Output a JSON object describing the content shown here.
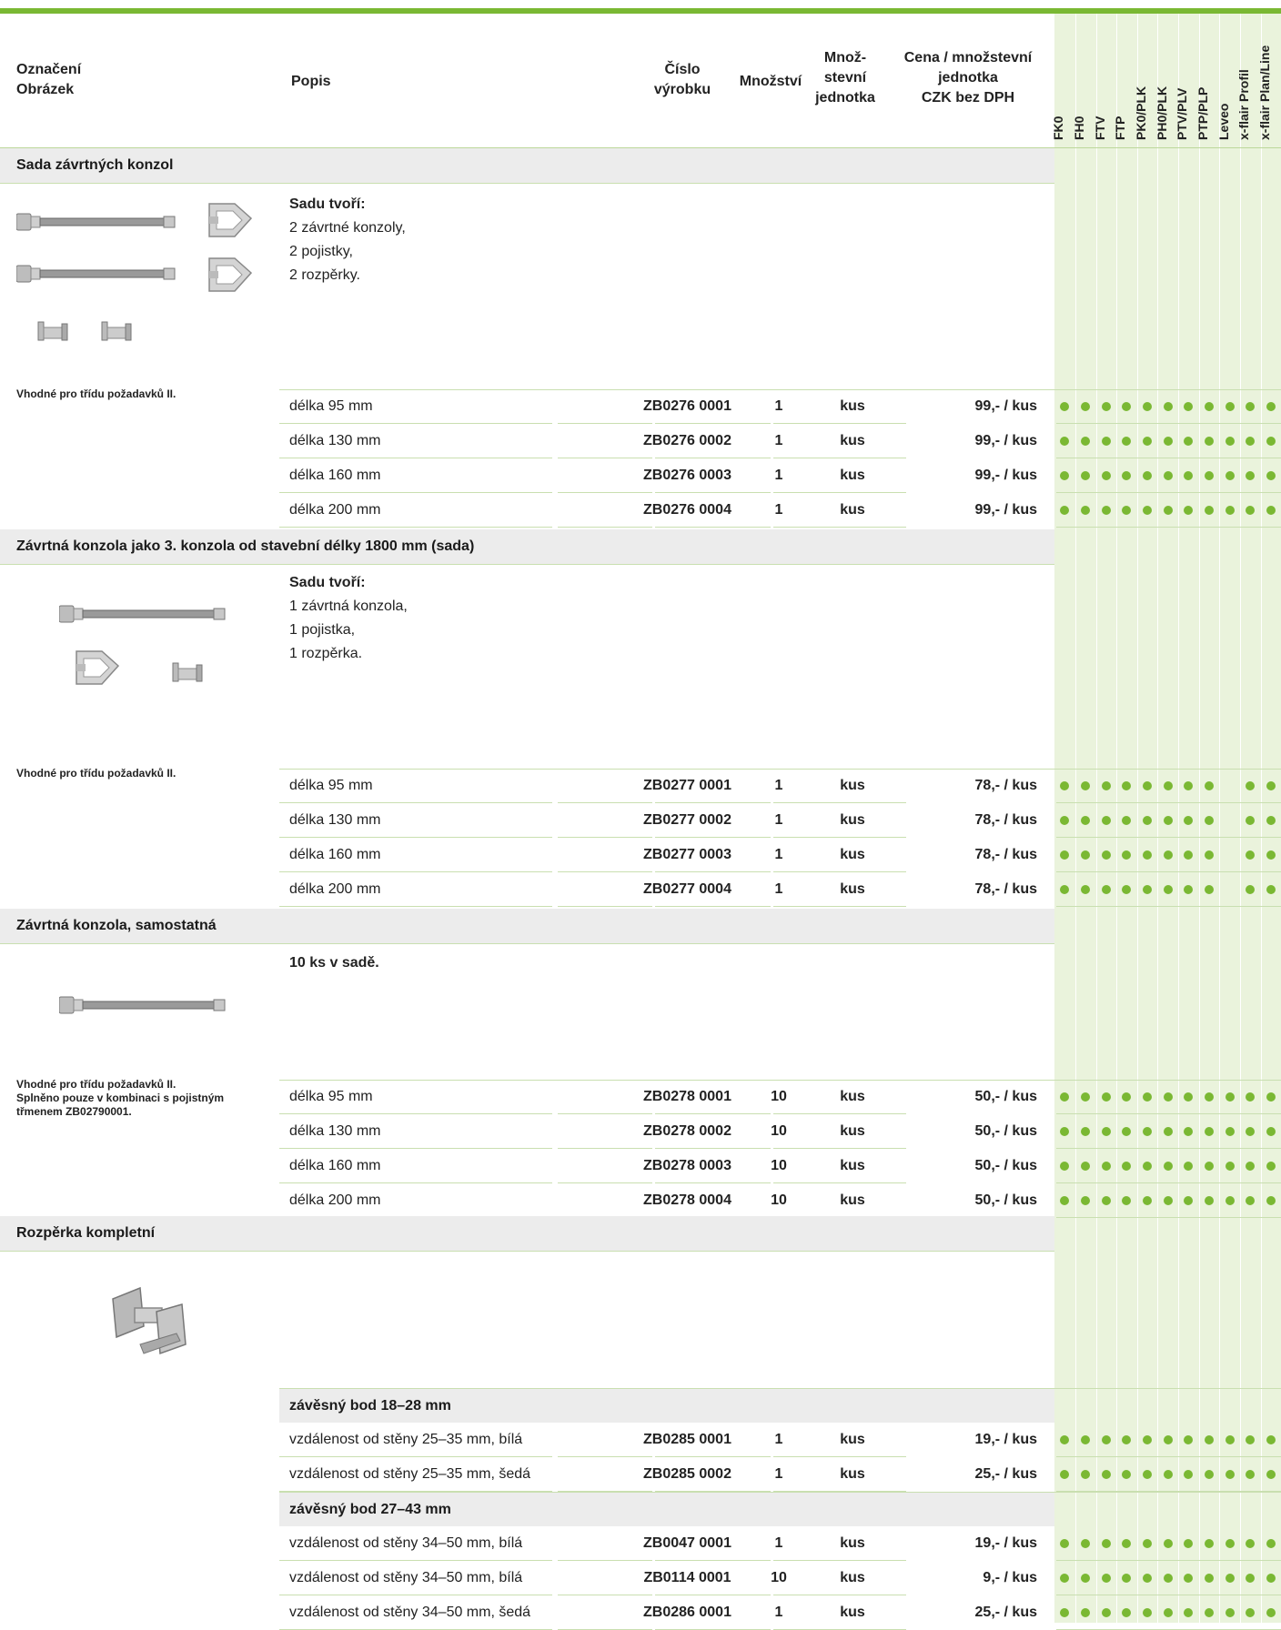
{
  "colors": {
    "accent": "#7ab833",
    "band": "#eaf3dc",
    "section_bg": "#ececec"
  },
  "header": {
    "col1_line1": "Označení",
    "col1_line2": "Obrázek",
    "col2": "Popis",
    "col3_line1": "Číslo",
    "col3_line2": "výrobku",
    "col4": "Množství",
    "col5_line1": "Množ-",
    "col5_line2": "stevní",
    "col5_line3": "jednotka",
    "col6_line1": "Cena / množstevní",
    "col6_line2": "jednotka",
    "col6_line3": "CZK bez DPH",
    "compat": [
      "FK0",
      "FH0",
      "FTV",
      "FTP",
      "PK0/PLK",
      "PH0/PLK",
      "PTV/PLV",
      "PTP/PLP",
      "Leveo",
      "x-flair Profil",
      "x-flair Plan/Line"
    ]
  },
  "sections": [
    {
      "title": "Sada závrtných konzol",
      "desc_bold": "Sadu tvoří:",
      "desc_lines": [
        "2 závrtné konzoly,",
        "2 pojistky,",
        "2 rozpěrky."
      ],
      "note": "Vhodné pro třídu požadavků II.",
      "rows": [
        {
          "label": "délka 95 mm",
          "number": "ZB0276 0001",
          "qty": "1",
          "unit": "kus",
          "price": "99,- / kus",
          "compat": [
            1,
            1,
            1,
            1,
            1,
            1,
            1,
            1,
            1,
            1,
            1
          ]
        },
        {
          "label": "délka 130 mm",
          "number": "ZB0276 0002",
          "qty": "1",
          "unit": "kus",
          "price": "99,- / kus",
          "compat": [
            1,
            1,
            1,
            1,
            1,
            1,
            1,
            1,
            1,
            1,
            1
          ]
        },
        {
          "label": "délka 160 mm",
          "number": "ZB0276 0003",
          "qty": "1",
          "unit": "kus",
          "price": "99,- / kus",
          "compat": [
            1,
            1,
            1,
            1,
            1,
            1,
            1,
            1,
            1,
            1,
            1
          ]
        },
        {
          "label": "délka 200 mm",
          "number": "ZB0276 0004",
          "qty": "1",
          "unit": "kus",
          "price": "99,- / kus",
          "compat": [
            1,
            1,
            1,
            1,
            1,
            1,
            1,
            1,
            1,
            1,
            1
          ]
        }
      ]
    },
    {
      "title": "Závrtná konzola jako 3. konzola od stavební délky 1800 mm (sada)",
      "desc_bold": "Sadu tvoří:",
      "desc_lines": [
        "1 závrtná konzola,",
        "1 pojistka,",
        "1 rozpěrka."
      ],
      "note": "Vhodné pro třídu požadavků II.",
      "rows": [
        {
          "label": "délka 95 mm",
          "number": "ZB0277 0001",
          "qty": "1",
          "unit": "kus",
          "price": "78,- / kus",
          "compat": [
            1,
            1,
            1,
            1,
            1,
            1,
            1,
            1,
            0,
            1,
            1
          ]
        },
        {
          "label": "délka 130 mm",
          "number": "ZB0277 0002",
          "qty": "1",
          "unit": "kus",
          "price": "78,- / kus",
          "compat": [
            1,
            1,
            1,
            1,
            1,
            1,
            1,
            1,
            0,
            1,
            1
          ]
        },
        {
          "label": "délka 160 mm",
          "number": "ZB0277 0003",
          "qty": "1",
          "unit": "kus",
          "price": "78,- / kus",
          "compat": [
            1,
            1,
            1,
            1,
            1,
            1,
            1,
            1,
            0,
            1,
            1
          ]
        },
        {
          "label": "délka 200 mm",
          "number": "ZB0277 0004",
          "qty": "1",
          "unit": "kus",
          "price": "78,- / kus",
          "compat": [
            1,
            1,
            1,
            1,
            1,
            1,
            1,
            1,
            0,
            1,
            1
          ]
        }
      ]
    },
    {
      "title": "Závrtná konzola, samostatná",
      "desc_bold": "10 ks v sadě.",
      "desc_lines": [],
      "note": "Vhodné pro třídu požadavků II.\nSplněno pouze v kombinaci s pojistným\ntřmenem ZB02790001.",
      "rows": [
        {
          "label": "délka 95 mm",
          "number": "ZB0278 0001",
          "qty": "10",
          "unit": "kus",
          "price": "50,- / kus",
          "compat": [
            1,
            1,
            1,
            1,
            1,
            1,
            1,
            1,
            1,
            1,
            1
          ]
        },
        {
          "label": "délka 130 mm",
          "number": "ZB0278 0002",
          "qty": "10",
          "unit": "kus",
          "price": "50,- / kus",
          "compat": [
            1,
            1,
            1,
            1,
            1,
            1,
            1,
            1,
            1,
            1,
            1
          ]
        },
        {
          "label": "délka 160 mm",
          "number": "ZB0278 0003",
          "qty": "10",
          "unit": "kus",
          "price": "50,- / kus",
          "compat": [
            1,
            1,
            1,
            1,
            1,
            1,
            1,
            1,
            1,
            1,
            1
          ]
        },
        {
          "label": "délka 200 mm",
          "number": "ZB0278 0004",
          "qty": "10",
          "unit": "kus",
          "price": "50,- / kus",
          "compat": [
            1,
            1,
            1,
            1,
            1,
            1,
            1,
            1,
            1,
            1,
            1
          ]
        }
      ]
    },
    {
      "title": "Rozpěrka kompletní",
      "subgroups": [
        {
          "title": "závěsný bod 18–28 mm",
          "rows": [
            {
              "label": "vzdálenost od stěny 25–35 mm, bílá",
              "number": "ZB0285 0001",
              "qty": "1",
              "unit": "kus",
              "price": "19,- / kus",
              "compat": [
                1,
                1,
                1,
                1,
                1,
                1,
                1,
                1,
                1,
                1,
                1
              ]
            },
            {
              "label": "vzdálenost od stěny 25–35 mm, šedá",
              "number": "ZB0285 0002",
              "qty": "1",
              "unit": "kus",
              "price": "25,- / kus",
              "compat": [
                1,
                1,
                1,
                1,
                1,
                1,
                1,
                1,
                1,
                1,
                1
              ]
            }
          ]
        },
        {
          "title": "závěsný bod 27–43 mm",
          "rows": [
            {
              "label": "vzdálenost od stěny 34–50 mm, bílá",
              "number": "ZB0047 0001",
              "qty": "1",
              "unit": "kus",
              "price": "19,- / kus",
              "compat": [
                1,
                1,
                1,
                1,
                1,
                1,
                1,
                1,
                1,
                1,
                1
              ]
            },
            {
              "label": "vzdálenost od stěny 34–50 mm, bílá",
              "number": "ZB0114 0001",
              "qty": "10",
              "unit": "kus",
              "price": "9,- / kus",
              "compat": [
                1,
                1,
                1,
                1,
                1,
                1,
                1,
                1,
                1,
                1,
                1
              ]
            },
            {
              "label": "vzdálenost od stěny 34–50 mm, šedá",
              "number": "ZB0286 0001",
              "qty": "1",
              "unit": "kus",
              "price": "25,- / kus",
              "compat": [
                1,
                1,
                1,
                1,
                1,
                1,
                1,
                1,
                1,
                1,
                1
              ]
            }
          ]
        }
      ]
    }
  ]
}
